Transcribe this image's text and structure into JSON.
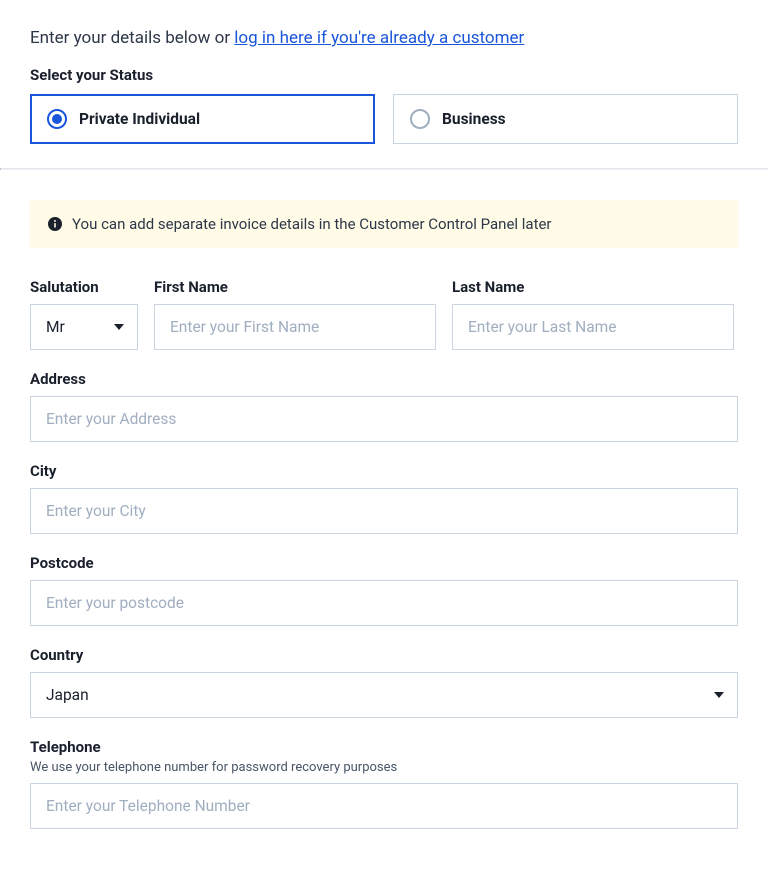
{
  "intro": {
    "prefix": "Enter your details below or ",
    "link": "log in here if you're already a customer"
  },
  "status": {
    "label": "Select your Status",
    "options": {
      "private": "Private Individual",
      "business": "Business"
    }
  },
  "notice": "You can add separate invoice details in the Customer Control Panel later",
  "salutation": {
    "label": "Salutation",
    "value": "Mr"
  },
  "firstName": {
    "label": "First Name",
    "placeholder": "Enter your First Name"
  },
  "lastName": {
    "label": "Last Name",
    "placeholder": "Enter your Last Name"
  },
  "address": {
    "label": "Address",
    "placeholder": "Enter your Address"
  },
  "city": {
    "label": "City",
    "placeholder": "Enter your City"
  },
  "postcode": {
    "label": "Postcode",
    "placeholder": "Enter your postcode"
  },
  "country": {
    "label": "Country",
    "value": "Japan"
  },
  "telephone": {
    "label": "Telephone",
    "sublabel": "We use your telephone number for password recovery purposes",
    "placeholder": "Enter your Telephone Number"
  }
}
